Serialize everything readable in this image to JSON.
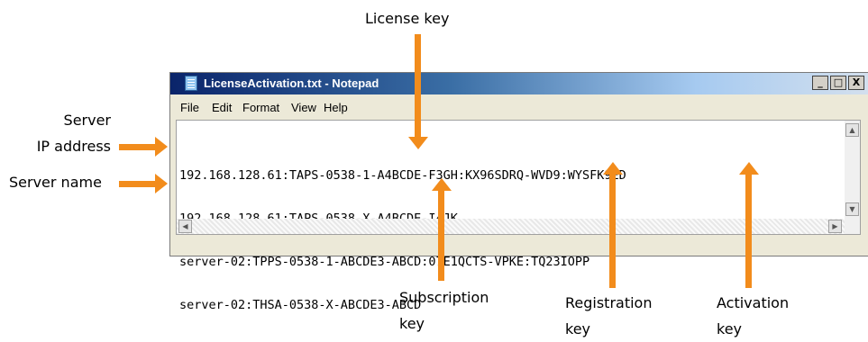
{
  "callouts": {
    "license_key": "License key",
    "server_ip_line1": "Server",
    "server_ip_line2": "IP address",
    "server_name": "Server name",
    "subscription_line1": "Subscription",
    "subscription_line2": "key",
    "registration_line1": "Registration",
    "registration_line2": "key",
    "activation_line1": "Activation",
    "activation_line2": "key"
  },
  "window": {
    "title": "LicenseActivation.txt - Notepad",
    "buttons": [
      "_",
      "□",
      "X"
    ]
  },
  "menu": [
    "File",
    "Edit",
    "Format",
    "View",
    "Help"
  ],
  "lines": [
    "192.168.128.61:TAPS-0538-1-A4BCDE-F3GH:KX96SDRQ-WVD9:WYSFK9ED",
    "192.168.128.61:TAPS-0538-X-A4BCDE-I4JK",
    "server-02:TPPS-0538-1-ABCDE3-ABCD:07E1QCTS-VPKE:TQ23IOPP",
    "server-02:THSA-0538-X-ABCDE3-ABCD"
  ],
  "colors": {
    "arrow": "#f28c1c",
    "title_bar": "#0a246a"
  }
}
